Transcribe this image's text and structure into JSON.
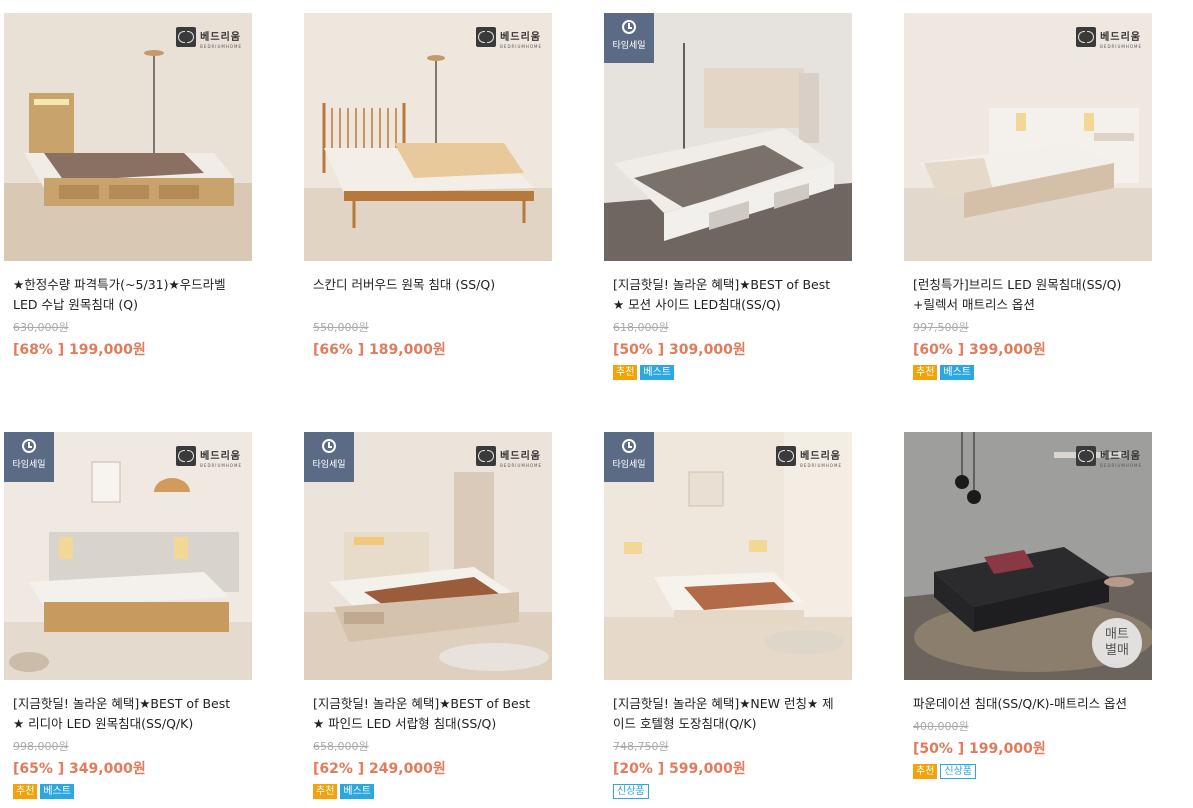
{
  "brand": {
    "name": "베드리움",
    "sub": "BEDRIUMHOME"
  },
  "timesale_label": "타임세일",
  "soldout_label": [
    "매트",
    "별매"
  ],
  "products": [
    {
      "title": "★한정수량 파격특가(~5/31)★우드라벨 LED 수납 원목침대 (Q)",
      "original": "630,000원",
      "price": "[68% ] 199,000원"
    },
    {
      "title": "스칸디 러버우드 원목 침대 (SS/Q)",
      "original": "550,000원",
      "price": "[66% ] 189,000원"
    },
    {
      "title": "[지금핫딜! 놀라운 혜택]★BEST of Best ★ 모션 사이드 LED침대(SS/Q)",
      "original": "618,000원",
      "price": "[50% ] 309,000원",
      "badges": [
        "추천",
        "베스트"
      ]
    },
    {
      "title": "[런칭특가]브리드 LED 원목침대(SS/Q) +릴렉서 매트리스 옵션",
      "original": "997,500원",
      "price": "[60% ] 399,000원",
      "badges": [
        "추천",
        "베스트"
      ]
    },
    {
      "title": "[지금핫딜! 놀라운 혜택]★BEST of Best ★ 리디아 LED 원목침대(SS/Q/K)",
      "original": "998,000원",
      "price": "[65% ] 349,000원",
      "badges": [
        "추천",
        "베스트"
      ]
    },
    {
      "title": "[지금핫딜! 놀라운 혜택]★BEST of Best ★ 파인드 LED 서랍형 침대(SS/Q)",
      "original": "658,000원",
      "price": "[62% ] 249,000원",
      "badges": [
        "추천",
        "베스트"
      ]
    },
    {
      "title": "[지금핫딜! 놀라운 혜택]★NEW 런칭★ 제이드 호텔형 도장침대(Q/K)",
      "original": "748,750원",
      "price": "[20% ] 599,000원",
      "badges": [
        "신상품"
      ]
    },
    {
      "title": "파운데이션 침대(SS/Q/K)-매트리스 옵션",
      "original": "400,000원",
      "price": "[50% ] 199,000원",
      "badges": [
        "추천",
        "신상품"
      ]
    }
  ]
}
